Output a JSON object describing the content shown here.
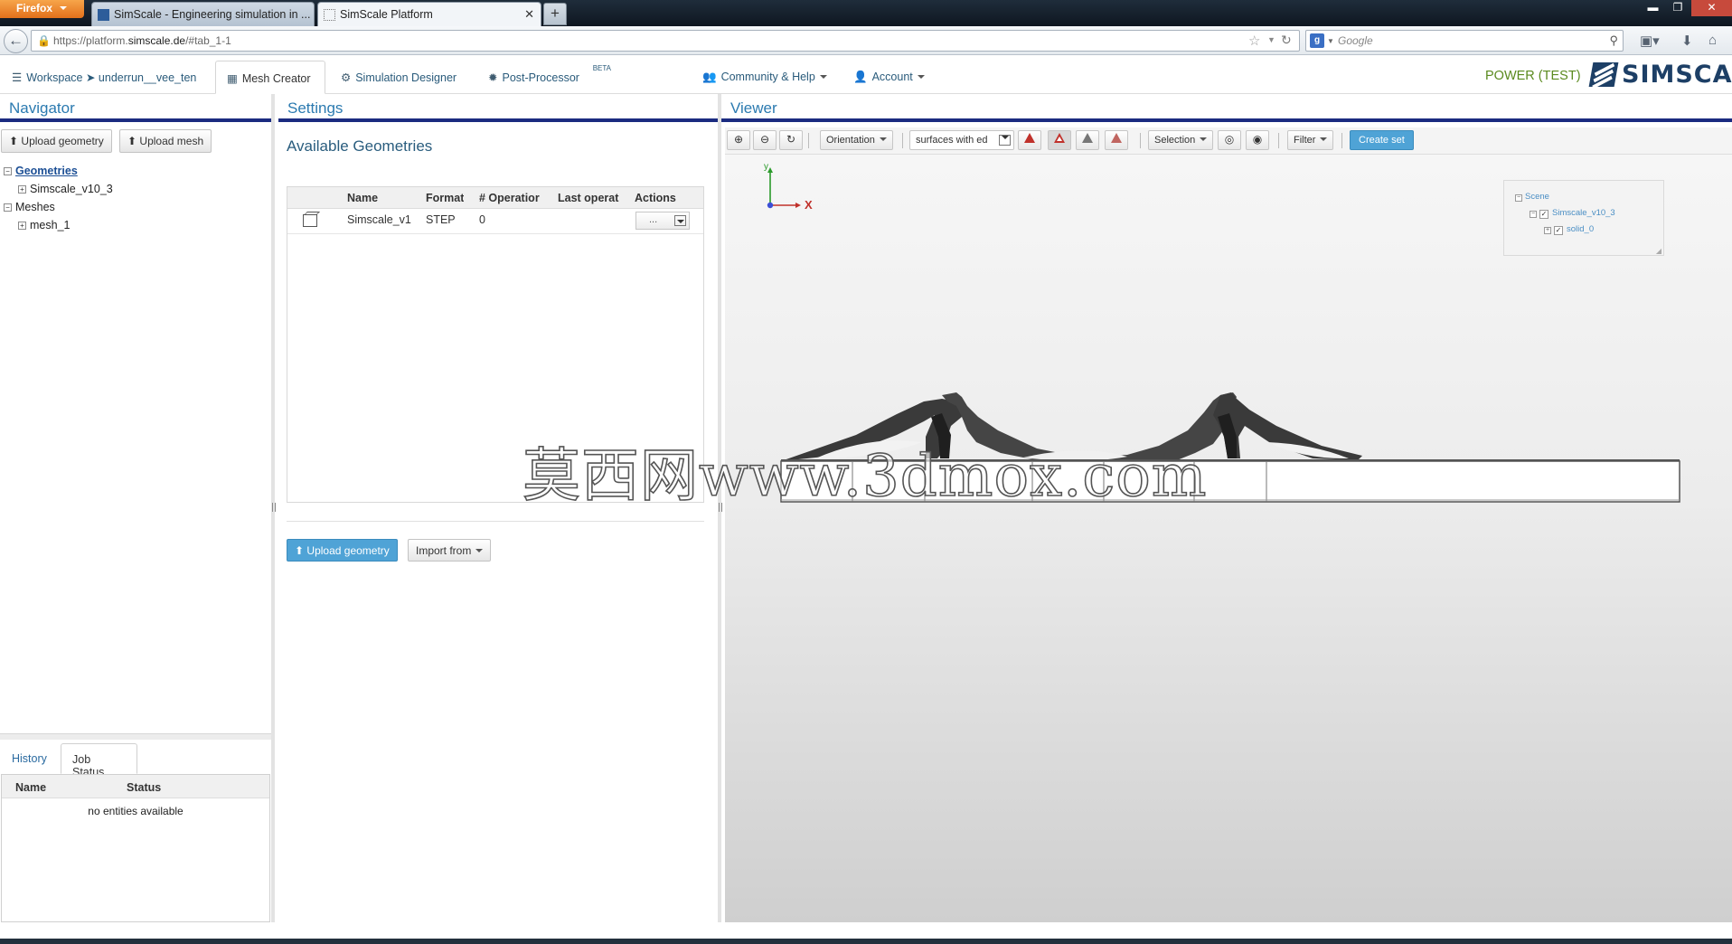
{
  "browser": {
    "menu_label": "Firefox",
    "tabs": [
      {
        "title": "SimScale - Engineering simulation in ..."
      },
      {
        "title": "SimScale Platform"
      }
    ],
    "new_tab": "+",
    "url_prefix": "https://platform.",
    "url_domain": "simscale.de",
    "url_suffix": "/#tab_1-1",
    "search_placeholder": "Google",
    "search_engine_icon": "g"
  },
  "header": {
    "tabs": [
      {
        "label": "Workspace ➤ underrun__vee_ten",
        "icon": "workspace-icon"
      },
      {
        "label": "Mesh Creator",
        "icon": "grid-icon"
      },
      {
        "label": "Simulation Designer",
        "icon": "gears-icon"
      },
      {
        "label": "Post-Processor",
        "icon": "gear-icon",
        "badge": "BETA"
      },
      {
        "label": "Community & Help",
        "icon": "users-icon"
      },
      {
        "label": "Account",
        "icon": "user-icon"
      }
    ],
    "plan": "POWER (TEST)",
    "logo_text": "SIMSCALE"
  },
  "navigator": {
    "title": "Navigator",
    "upload_geometry": "Upload geometry",
    "upload_mesh": "Upload mesh",
    "tree": {
      "geometries": "Geometries",
      "geometry_child": "Simscale_v10_3",
      "meshes": "Meshes",
      "mesh_child": "mesh_1"
    },
    "bottom_tabs": {
      "history": "History",
      "job_status": "Job Status"
    },
    "jobs_columns": {
      "name": "Name",
      "status": "Status"
    },
    "jobs_empty": "no entities available"
  },
  "settings": {
    "title": "Settings",
    "section_title": "Available Geometries",
    "columns": {
      "name": "Name",
      "format": "Format",
      "operations": "# Operatior",
      "last_op": "Last operat",
      "actions": "Actions"
    },
    "rows": [
      {
        "name": "Simscale_v1",
        "format": "STEP",
        "operations": "0",
        "last_op": "",
        "action": "..."
      }
    ],
    "upload_geometry": "Upload geometry",
    "import_from": "Import from"
  },
  "viewer": {
    "title": "Viewer",
    "toolbar": {
      "orientation": "Orientation",
      "render_mode": "surfaces with ed",
      "selection": "Selection",
      "filter": "Filter",
      "create_set": "Create set"
    },
    "axes": {
      "y": "y",
      "x": "X"
    },
    "scene_tree": {
      "root": "Scene",
      "child": "Simscale_v10_3",
      "leaf": "solid_0"
    }
  },
  "watermark": "莫西网www.3dmox.com",
  "colors": {
    "accent": "#2b7ab0",
    "panel_bar": "#1b2b80",
    "primary_button": "#4fa3d6",
    "plan": "#5a8a1e",
    "logo": "#1d3f66"
  }
}
